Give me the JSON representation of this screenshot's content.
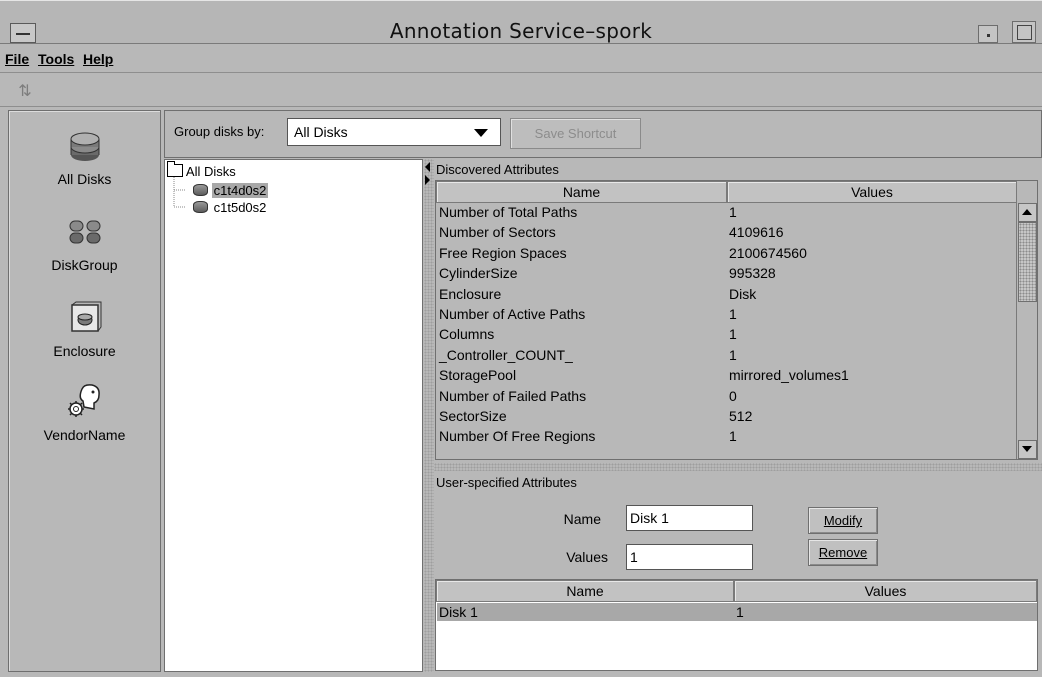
{
  "window": {
    "title": "Annotation Service–spork"
  },
  "menubar": {
    "items": [
      {
        "label": "File"
      },
      {
        "label": "Tools"
      },
      {
        "label": "Help"
      }
    ]
  },
  "toolbar": {
    "refresh_icon": "refresh-icon"
  },
  "nav": {
    "items": [
      {
        "label": "All Disks",
        "icon": "disks-icon"
      },
      {
        "label": "DiskGroup",
        "icon": "diskgroup-icon"
      },
      {
        "label": "Enclosure",
        "icon": "enclosure-icon"
      },
      {
        "label": "VendorName",
        "icon": "vendor-icon"
      }
    ]
  },
  "groupbar": {
    "label": "Group disks by:",
    "selected": "All Disks",
    "save_button": "Save Shortcut"
  },
  "tree": {
    "root": "All Disks",
    "children": [
      {
        "label": "c1t4d0s2",
        "selected": true
      },
      {
        "label": "c1t5d0s2",
        "selected": false
      }
    ]
  },
  "discovered": {
    "title": "Discovered Attributes",
    "columns": [
      "Name",
      "Values"
    ],
    "rows": [
      {
        "name": "Number of Total Paths",
        "value": "1"
      },
      {
        "name": "Number of Sectors",
        "value": "4109616"
      },
      {
        "name": "Free Region Spaces",
        "value": "2100674560"
      },
      {
        "name": "CylinderSize",
        "value": "995328"
      },
      {
        "name": "Enclosure",
        "value": "Disk"
      },
      {
        "name": "Number of Active Paths",
        "value": "1"
      },
      {
        "name": "Columns",
        "value": "1"
      },
      {
        "name": "_Controller_COUNT_",
        "value": "1"
      },
      {
        "name": "StoragePool",
        "value": "mirrored_volumes1"
      },
      {
        "name": "Number of Failed Paths",
        "value": "0"
      },
      {
        "name": "SectorSize",
        "value": "512"
      },
      {
        "name": "Number Of Free Regions",
        "value": "1"
      }
    ]
  },
  "user_specified": {
    "title": "User-specified Attributes",
    "name_label": "Name",
    "name_value": "Disk 1",
    "values_label": "Values",
    "values_value": "1",
    "modify_button": "Modify",
    "remove_button": "Remove",
    "columns": [
      "Name",
      "Values"
    ],
    "rows": [
      {
        "name": "Disk 1",
        "value": "1",
        "selected": true
      }
    ]
  },
  "colors": {
    "window_bg": "#b8b8b8",
    "selection": "#a8a8a8",
    "field_bg": "#ffffff"
  }
}
